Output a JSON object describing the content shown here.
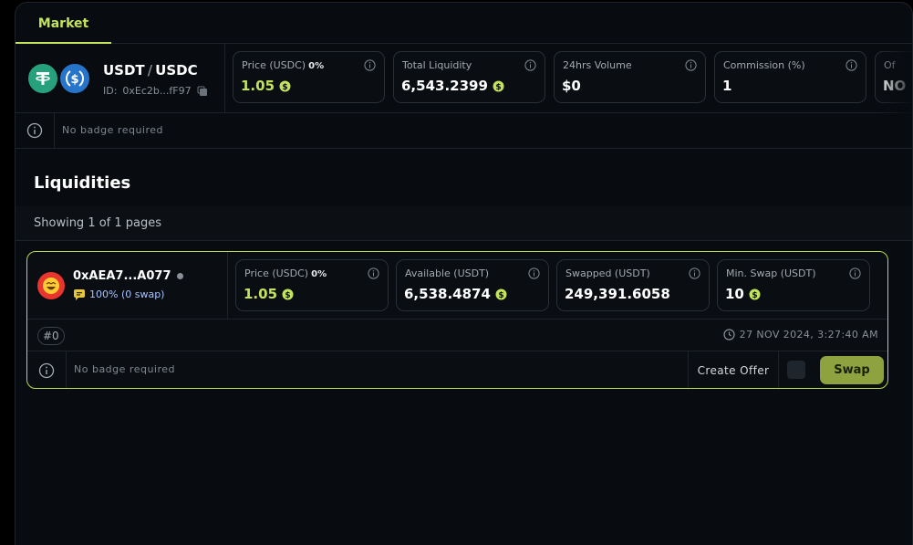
{
  "tabs": {
    "market": "Market"
  },
  "pair": {
    "base": "USDT",
    "separator": "/",
    "quote": "USDC",
    "id_label": "ID:",
    "id_value": "0xEc2b...fF97"
  },
  "market_stats": [
    {
      "label": "Price (USDC)",
      "extra": "0%",
      "value": "1.05",
      "green": true,
      "dollar": true
    },
    {
      "label": "Total Liquidity",
      "extra": "",
      "value": "6,543.2399",
      "green": false,
      "dollar": true
    },
    {
      "label": "24hrs Volume",
      "extra": "",
      "value": "$0",
      "green": false,
      "dollar": false
    },
    {
      "label": "Commission (%)",
      "extra": "",
      "value": "1",
      "green": false,
      "dollar": false
    },
    {
      "label": "Of",
      "extra": "",
      "value": "NO",
      "green": false,
      "dollar": false
    }
  ],
  "market_badge": "No badge required",
  "section": {
    "title": "Liquidities",
    "showing": "Showing 1 of 1 pages"
  },
  "liquidity": {
    "owner": "0xAEA7...A077",
    "rate": "100% (0 swap)",
    "stats": [
      {
        "label": "Price (USDC)",
        "extra": "0%",
        "value": "1.05",
        "green": true,
        "dollar": true
      },
      {
        "label": "Available (USDT)",
        "extra": "",
        "value": "6,538.4874",
        "green": false,
        "dollar": true
      },
      {
        "label": "Swapped (USDT)",
        "extra": "",
        "value": "249,391.6058",
        "green": false,
        "dollar": false
      },
      {
        "label": "Min. Swap (USDT)",
        "extra": "",
        "value": "10",
        "green": false,
        "dollar": true
      }
    ],
    "nonce": "#0",
    "timestamp": "27 NOV 2024, 3:27:40 AM",
    "badge": "No badge required",
    "create_offer": "Create Offer",
    "swap": "Swap"
  },
  "colors": {
    "accent": "#c4e35c",
    "swap_button": "#8ea23f",
    "usdt": "#26a17b",
    "usdc": "#2775ca"
  }
}
